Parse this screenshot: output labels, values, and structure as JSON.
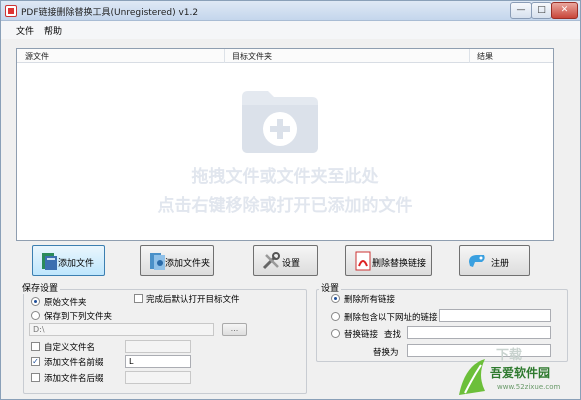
{
  "window": {
    "title": "PDF链接删除替换工具(Unregistered) v1.2",
    "controls": {
      "minimize": "—",
      "maximize": "□",
      "close": "✕"
    }
  },
  "menu": {
    "file": "文件",
    "help": "帮助"
  },
  "file_list": {
    "columns": {
      "source": "源文件",
      "target": "目标文件夹",
      "result": "结果"
    },
    "hint_line1": "拖拽文件或文件夹至此处",
    "hint_line2": "点击右键移除或打开已添加的文件",
    "icon": "folder-add-icon"
  },
  "toolbar": {
    "add_file": "添加文件",
    "add_folder": "添加文件夹",
    "settings": "设置",
    "delete_replace": "删除替换链接",
    "register": "注册"
  },
  "save_settings": {
    "title": "保存设置",
    "original_folder": "原始文件夹",
    "save_to_folder": "保存到下列文件夹",
    "folder_path": "D:\\",
    "browse": "...",
    "open_after": "完成后默认打开目标文件",
    "custom_name": "自定义文件名",
    "custom_name_value": "",
    "add_prefix": "添加文件名前缀",
    "prefix_value": "L",
    "add_suffix": "添加文件名后缀",
    "suffix_value": "",
    "state": {
      "original_folder_selected": true,
      "open_after_checked": false,
      "custom_name_checked": false,
      "add_prefix_checked": true,
      "add_suffix_checked": false
    }
  },
  "settings": {
    "title": "设置",
    "delete_all": "删除所有链接",
    "delete_containing": "删除包含以下网址的链接",
    "delete_containing_value": "",
    "replace_link": "替换链接",
    "find_label": "查找",
    "find_value": "",
    "replace_with_label": "替换为",
    "replace_with_value": "",
    "state": {
      "delete_all_selected": true
    }
  },
  "watermark": {
    "logo_text": "吾爱软件园",
    "url": "www.52zixue.com",
    "faint_text": "下载"
  }
}
